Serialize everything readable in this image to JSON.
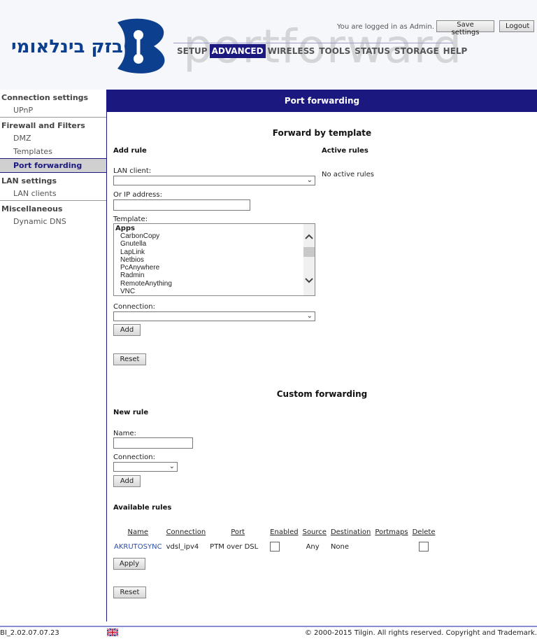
{
  "header": {
    "logo_text": "בזק בינלאומי",
    "login_text": "You are logged in as Admin.",
    "save_settings": "Save settings",
    "logout": "Logout",
    "watermark": "portforward",
    "nav": [
      "SETUP",
      "ADVANCED",
      "WIRELESS",
      "TOOLS",
      "STATUS",
      "STORAGE",
      "HELP"
    ],
    "nav_active": "ADVANCED"
  },
  "sidebar": {
    "groups": [
      {
        "label": "Connection settings",
        "items": [
          "UPnP"
        ]
      },
      {
        "label": "Firewall and Filters",
        "items": [
          "DMZ",
          "Templates",
          "Port forwarding"
        ]
      },
      {
        "label": "LAN settings",
        "items": [
          "LAN clients"
        ]
      },
      {
        "label": "Miscellaneous",
        "items": [
          "Dynamic DNS"
        ]
      }
    ],
    "active_item": "Port forwarding"
  },
  "page_title": "Port forwarding",
  "template_section": {
    "title": "Forward by template",
    "add_rule": "Add rule",
    "active_rules": "Active rules",
    "no_active_rules": "No active rules",
    "lan_client_label": "LAN client:",
    "lan_client_value": "",
    "ip_label": "Or IP address:",
    "ip_value": "",
    "template_label": "Template:",
    "template_group": "Apps",
    "template_options": [
      "CarbonCopy",
      "Gnutella",
      "LapLink",
      "Netbios",
      "PcAnywhere",
      "Radmin",
      "RemoteAnything",
      "VNC"
    ],
    "connection_label": "Connection:",
    "connection_value": "",
    "add_button": "Add",
    "reset_button": "Reset"
  },
  "custom_section": {
    "title": "Custom forwarding",
    "new_rule": "New rule",
    "name_label": "Name:",
    "name_value": "",
    "connection_label": "Connection:",
    "connection_value": "",
    "add_button": "Add",
    "available_rules": "Available rules",
    "columns": [
      "Name",
      "Connection",
      "Port",
      "Enabled",
      "Source",
      "Destination",
      "Portmaps",
      "Delete"
    ],
    "rows": [
      {
        "name": "AKRUTOSYNC",
        "connection": "vdsl_ipv4",
        "port": "PTM over DSL",
        "enabled": false,
        "source": "Any",
        "destination": "None",
        "portmaps": "",
        "delete": false
      }
    ],
    "apply_button": "Apply",
    "reset_button": "Reset"
  },
  "footer": {
    "version": "BI_2.02.07.07.23",
    "language_icon": "uk-flag-icon",
    "copyright": "© 2000-2015 Tilgin. All rights reserved. Copyright and Trademark."
  },
  "colors": {
    "brand": "#1b1880",
    "logo": "#0d3f8f",
    "link": "#2a4fb0"
  }
}
